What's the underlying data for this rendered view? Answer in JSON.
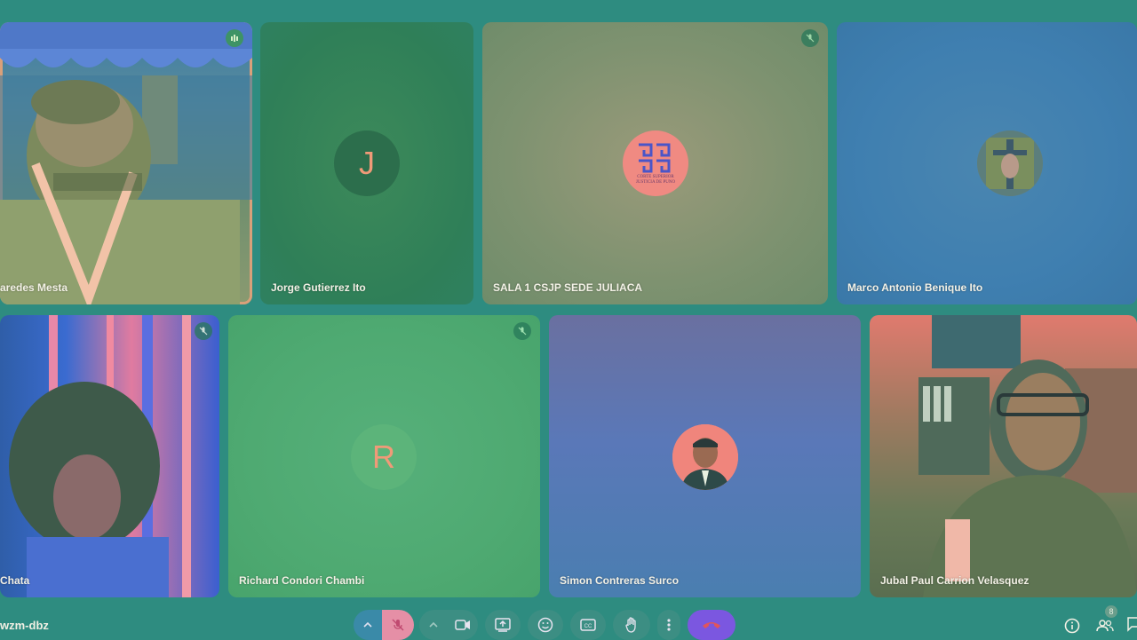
{
  "meeting": {
    "code": "wzm-dbz"
  },
  "participants": [
    {
      "name": "aredes Mesta",
      "video": true
    },
    {
      "name": "Jorge Gutierrez Ito",
      "initial": "J"
    },
    {
      "name": "SALA 1 CSJP SEDE JULIACA",
      "logo_text": "CORTE SUPERIOR JUSTICIA DE PUNO"
    },
    {
      "name": "Marco Antonio Benique Ito"
    },
    {
      "name": "Chata",
      "video": true
    },
    {
      "name": "Richard Condori Chambi",
      "initial": "R"
    },
    {
      "name": "Simon Contreras Surco"
    },
    {
      "name": "Jubal Paul Carrion Velasquez",
      "video": true
    }
  ],
  "people_count": "8",
  "colors": {
    "background": "#2e8c80",
    "end_call": "#7b57e0",
    "mic_off": "#e58fa6"
  }
}
